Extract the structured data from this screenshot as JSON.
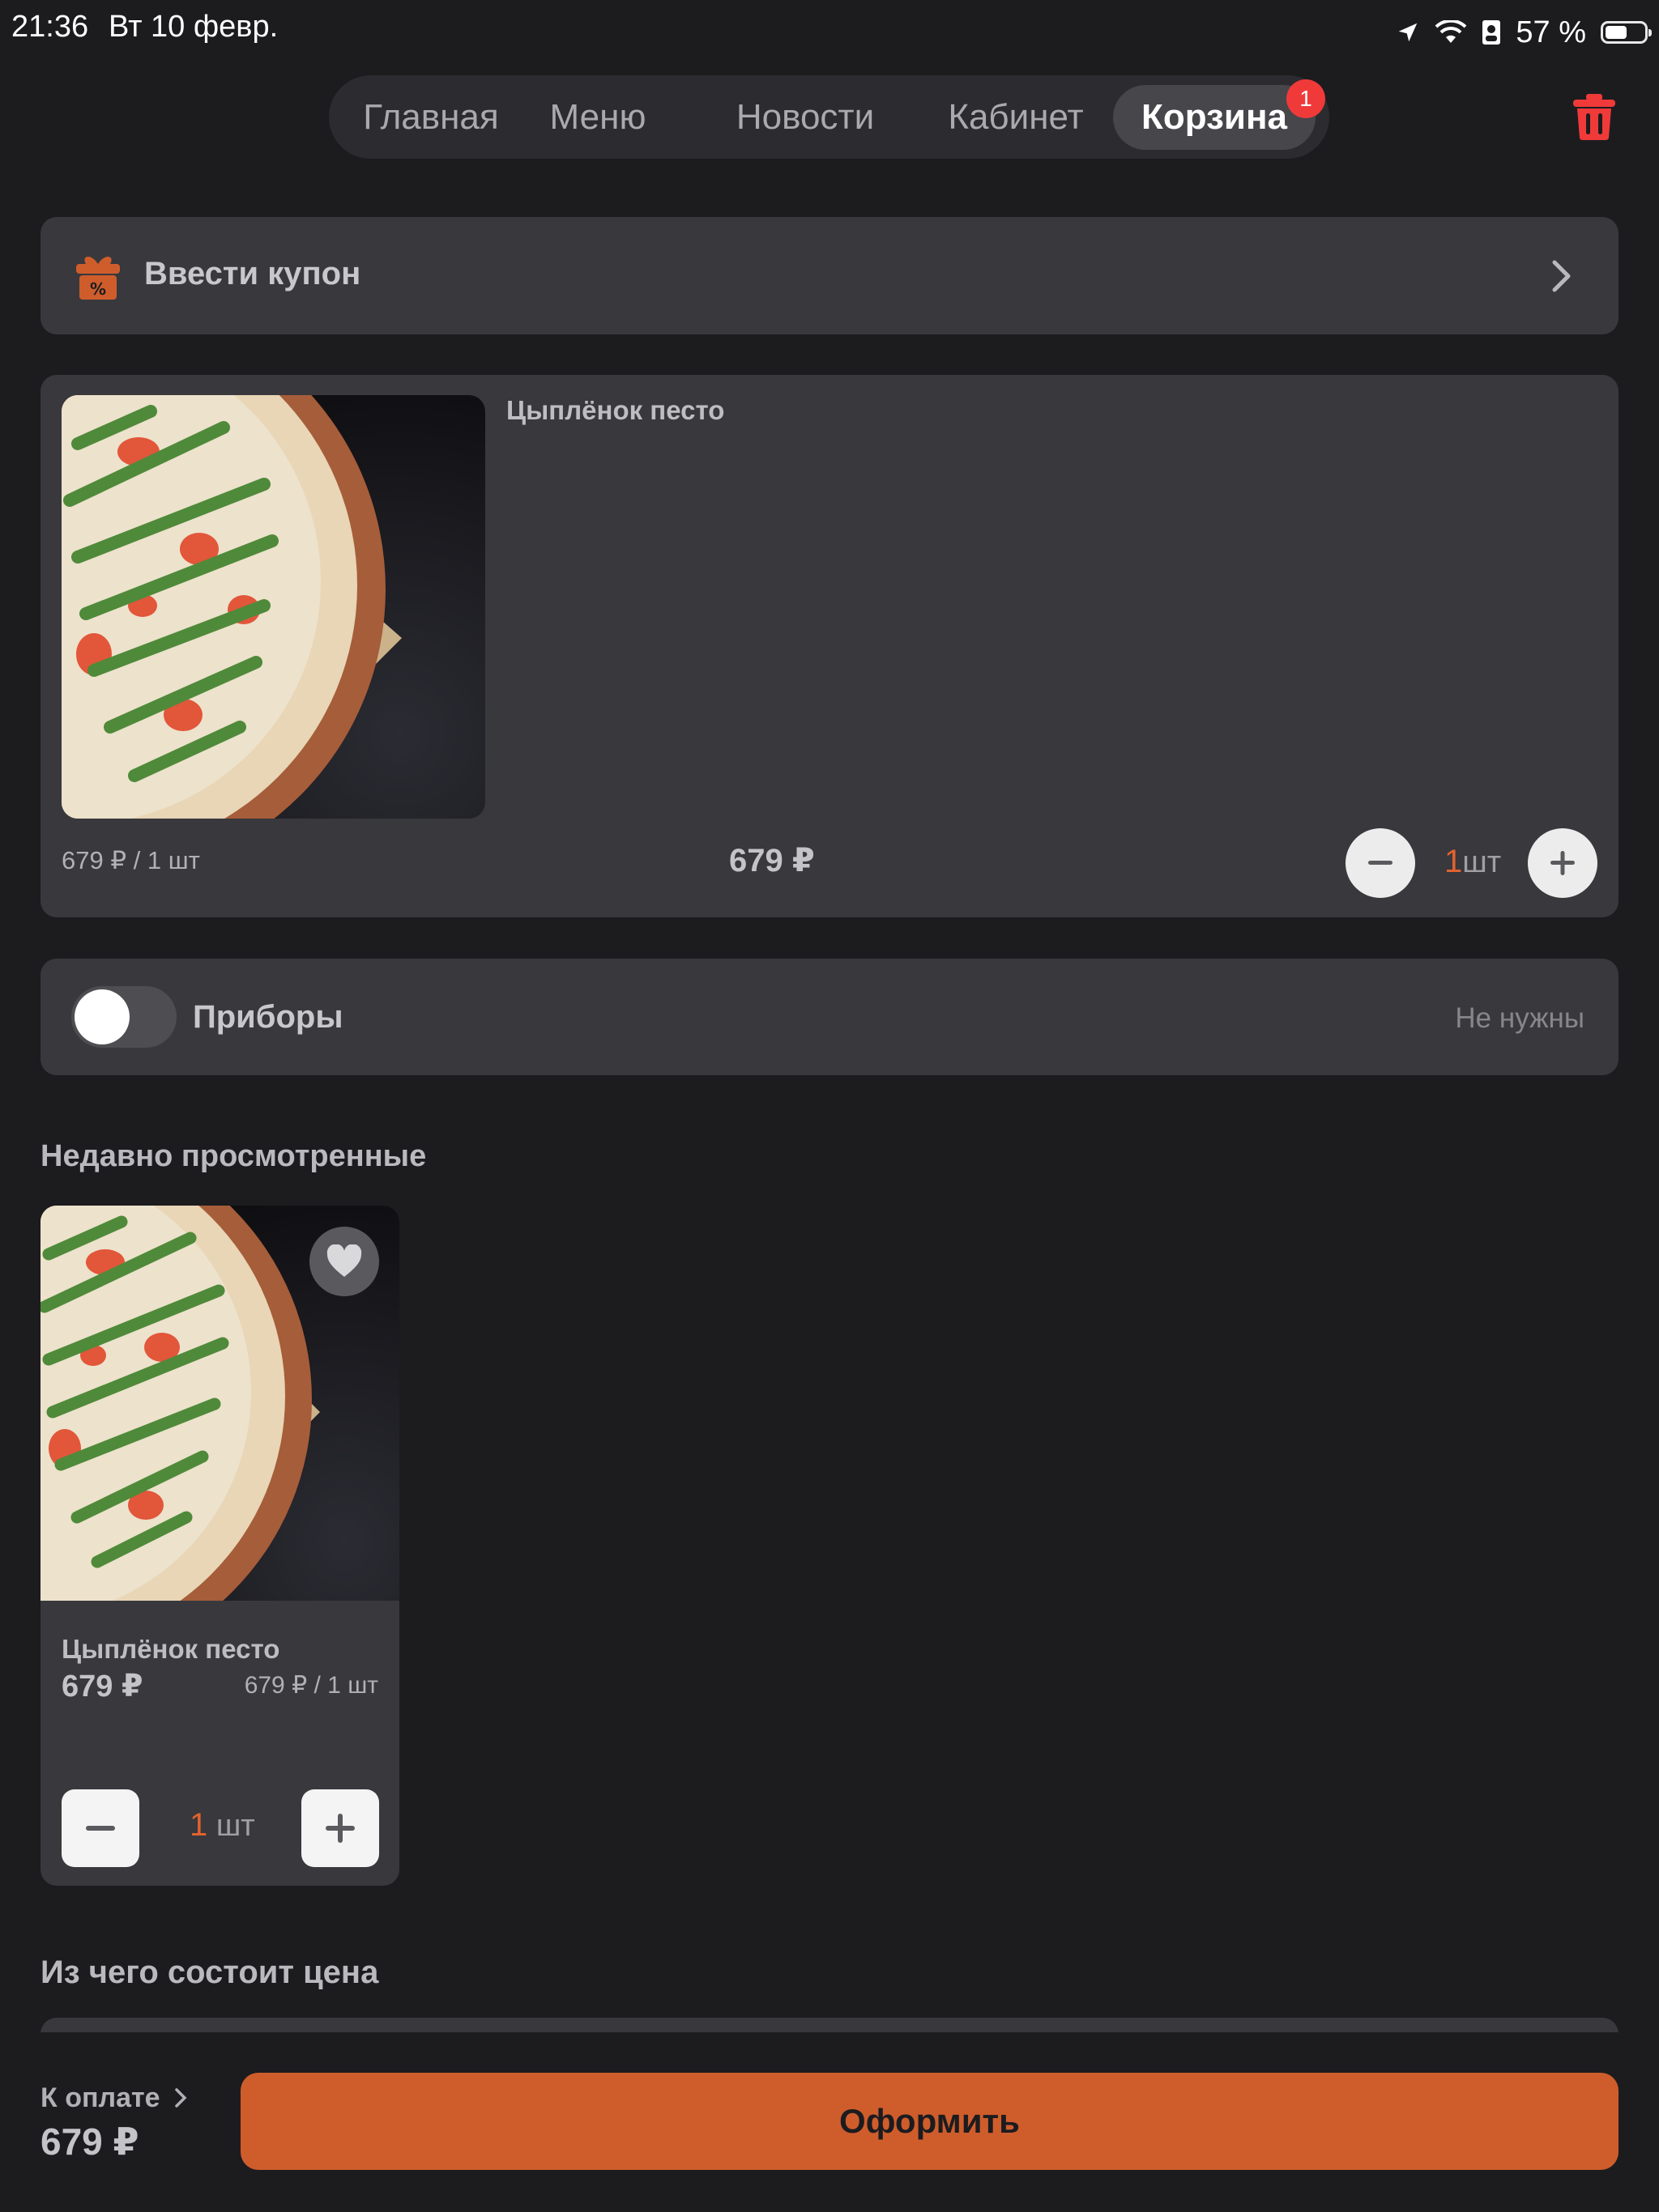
{
  "status_bar": {
    "time": "21:36",
    "date": "Вт 10 февр.",
    "battery_text": "57 %",
    "battery_level": 0.57,
    "icons": [
      "location-arrow-icon",
      "wifi-icon",
      "contact-badge-icon",
      "battery-icon"
    ]
  },
  "nav": {
    "tabs": [
      {
        "label": "Главная"
      },
      {
        "label": "Меню"
      },
      {
        "label": "Новости"
      },
      {
        "label": "Кабинет"
      },
      {
        "label": "Корзина",
        "active": true
      }
    ],
    "cart_badge": "1"
  },
  "coupon": {
    "label": "Ввести купон",
    "icon": "gift-percent-icon"
  },
  "cart_item": {
    "name": "Цыплёнок песто",
    "unit_price": "679 ₽ / 1 шт",
    "total": "679 ₽",
    "qty_value": "1",
    "qty_unit": "шт"
  },
  "cutlery": {
    "label": "Приборы",
    "value": "Не нужны",
    "enabled": false
  },
  "recent": {
    "title": "Недавно просмотренные",
    "item": {
      "name": "Цыплёнок песто",
      "price": "679 ₽",
      "unit_price": "679 ₽ / 1 шт",
      "qty_value": "1",
      "qty_unit": "шт"
    }
  },
  "price_breakdown": {
    "title": "Из чего состоит цена"
  },
  "footer": {
    "pay_label": "К оплате",
    "pay_total": "679 ₽",
    "checkout_label": "Оформить"
  },
  "colors": {
    "accent": "#cf5d2c",
    "badge": "#f03a3a",
    "panel": "#38383d",
    "background": "#1c1c1f"
  }
}
